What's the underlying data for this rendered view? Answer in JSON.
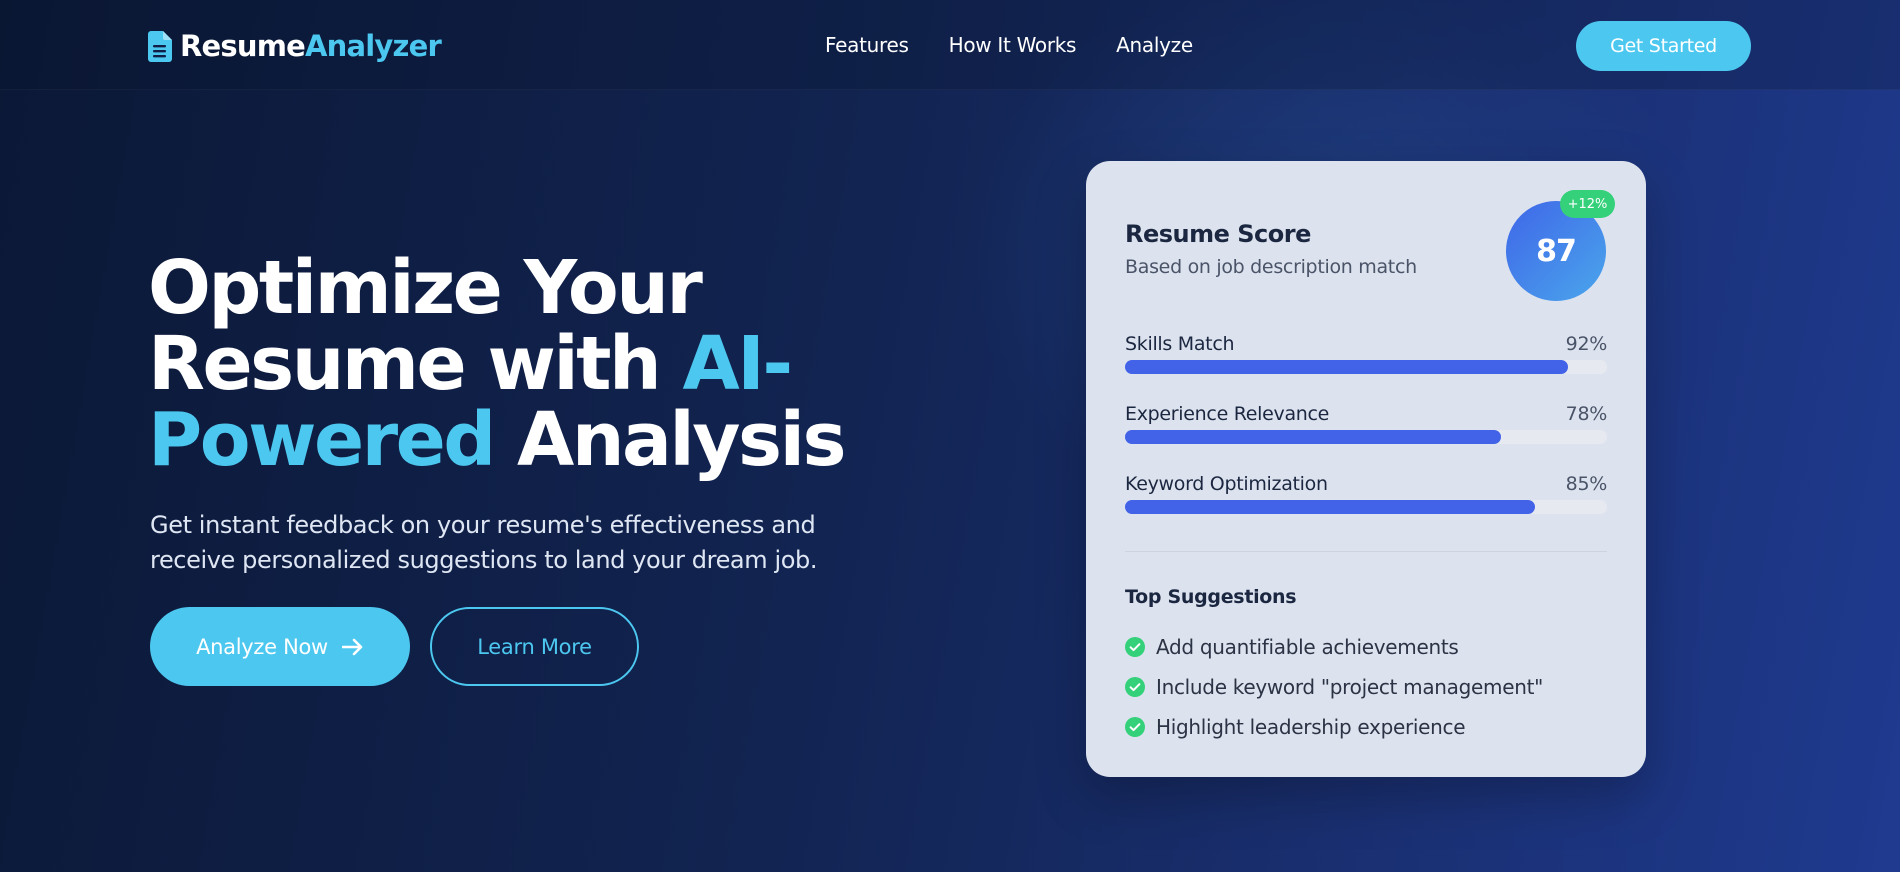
{
  "header": {
    "logo_icon": "document-icon",
    "logo_word_1": "Resume",
    "logo_word_2": "Analyzer",
    "nav": [
      {
        "label": "Features"
      },
      {
        "label": "How It Works"
      },
      {
        "label": "Analyze"
      }
    ],
    "cta_label": "Get Started"
  },
  "hero": {
    "title_part_1": "Optimize Your",
    "title_part_2": "Resume with ",
    "title_highlight_1": "AI-",
    "title_highlight_2": "Powered",
    "title_part_3": " Analysis",
    "subtitle": "Get instant feedback on your resume's effectiveness and receive personalized suggestions to land your dream job.",
    "primary_button": "Analyze Now",
    "primary_button_icon": "arrow-right-icon",
    "secondary_button": "Learn More"
  },
  "score_card": {
    "title": "Resume Score",
    "subtitle": "Based on job description match",
    "score": "87",
    "badge": "+12%",
    "metrics": [
      {
        "label": "Skills Match",
        "value": "92%",
        "fraction": 0.92
      },
      {
        "label": "Experience Relevance",
        "value": "78%",
        "fraction": 0.78
      },
      {
        "label": "Keyword Optimization",
        "value": "85%",
        "fraction": 0.85
      }
    ],
    "suggestions_title": "Top Suggestions",
    "suggestion_icon": "check-circle-icon",
    "suggestions": [
      "Add quantifiable achievements",
      "Include keyword \"project management\"",
      "Highlight leadership experience"
    ]
  },
  "colors": {
    "accent": "#4cc8f0",
    "bar_fill": "#4263e8",
    "badge_green": "#34d07a",
    "background_dark": "#0b1836",
    "background_light": "#1f3a8f"
  }
}
